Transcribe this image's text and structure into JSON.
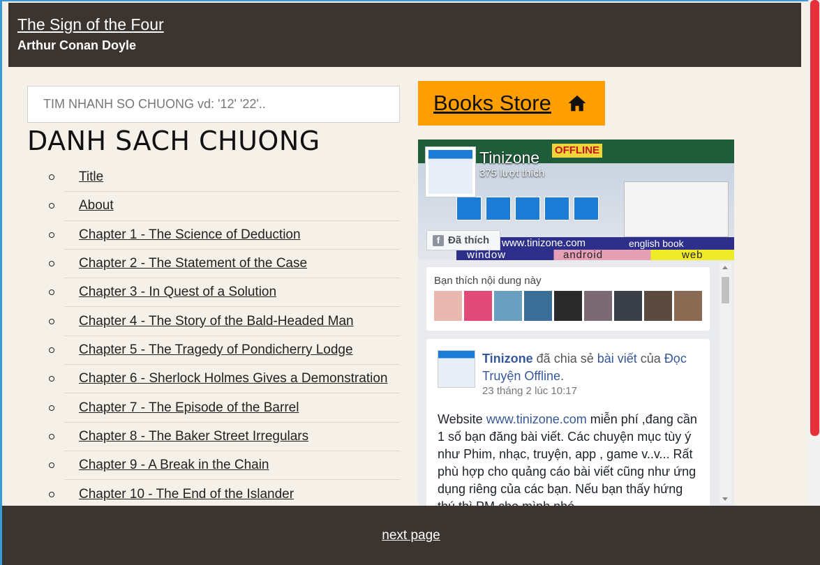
{
  "header": {
    "title": "The Sign of the Four",
    "author": "Arthur Conan Doyle"
  },
  "search": {
    "placeholder": "TIM NHANH SO CHUONG vd: '12' '22'.."
  },
  "list_title": "DANH SACH CHUONG",
  "chapters": [
    "Title",
    "About",
    "Chapter 1 - The Science of Deduction",
    "Chapter 2 - The Statement of the Case",
    "Chapter 3 - In Quest of a Solution",
    "Chapter 4 - The Story of the Bald-Headed Man",
    "Chapter 5 - The Tragedy of Pondicherry Lodge",
    "Chapter 6 - Sherlock Holmes Gives a Demonstration",
    "Chapter 7 - The Episode of the Barrel",
    "Chapter 8 - The Baker Street Irregulars",
    "Chapter 9 - A Break in the Chain",
    "Chapter 10 - The End of the Islander"
  ],
  "store_button": {
    "label": "Books Store",
    "icon": "home-icon"
  },
  "fb": {
    "page_name": "Tinizone",
    "likes": "375 lượt thích",
    "liked_label": "Đã thích",
    "cover": {
      "offline": "OFFLINE",
      "url": "www.tinizone.com",
      "english": "english book",
      "row2": [
        "window",
        "android",
        "web"
      ]
    },
    "friends_label": "Bạn thích nội dung này",
    "friend_colors": [
      "#e9b8b0",
      "#e04a78",
      "#6a9fbf",
      "#3c6e9a",
      "#2a2a2a",
      "#7b6a73",
      "#3a3f48",
      "#5a4a40",
      "#8a6a52"
    ],
    "post": {
      "author": "Tinizone",
      "shared_text": " đã chia sẻ ",
      "post_link": "bài viết",
      "of_text": " của ",
      "source": "Đọc Truyện Offline",
      "end": ".",
      "time": "23 tháng 2 lúc 10:17",
      "body_start": "Website ",
      "body_link": "www.tinizone.com",
      "body_rest": " miễn phí ,đang cần 1 số bạn đăng bài viết. Các chuyện mục tùy ý như Phim, nhạc, truyện, app , game v..v... Rất phù hợp cho quảng cáo bài viết cũng như ứng dụng riêng của các bạn. Nếu bạn thấy hứng thú thì PM cho mình nhé."
    }
  },
  "footer": {
    "next_label": "next page"
  },
  "colors": {
    "header_bg": "#3b342f",
    "page_bg": "#f5f1e8",
    "store_bg": "#ff9e00",
    "scroll_thumb": "#e8303a"
  }
}
